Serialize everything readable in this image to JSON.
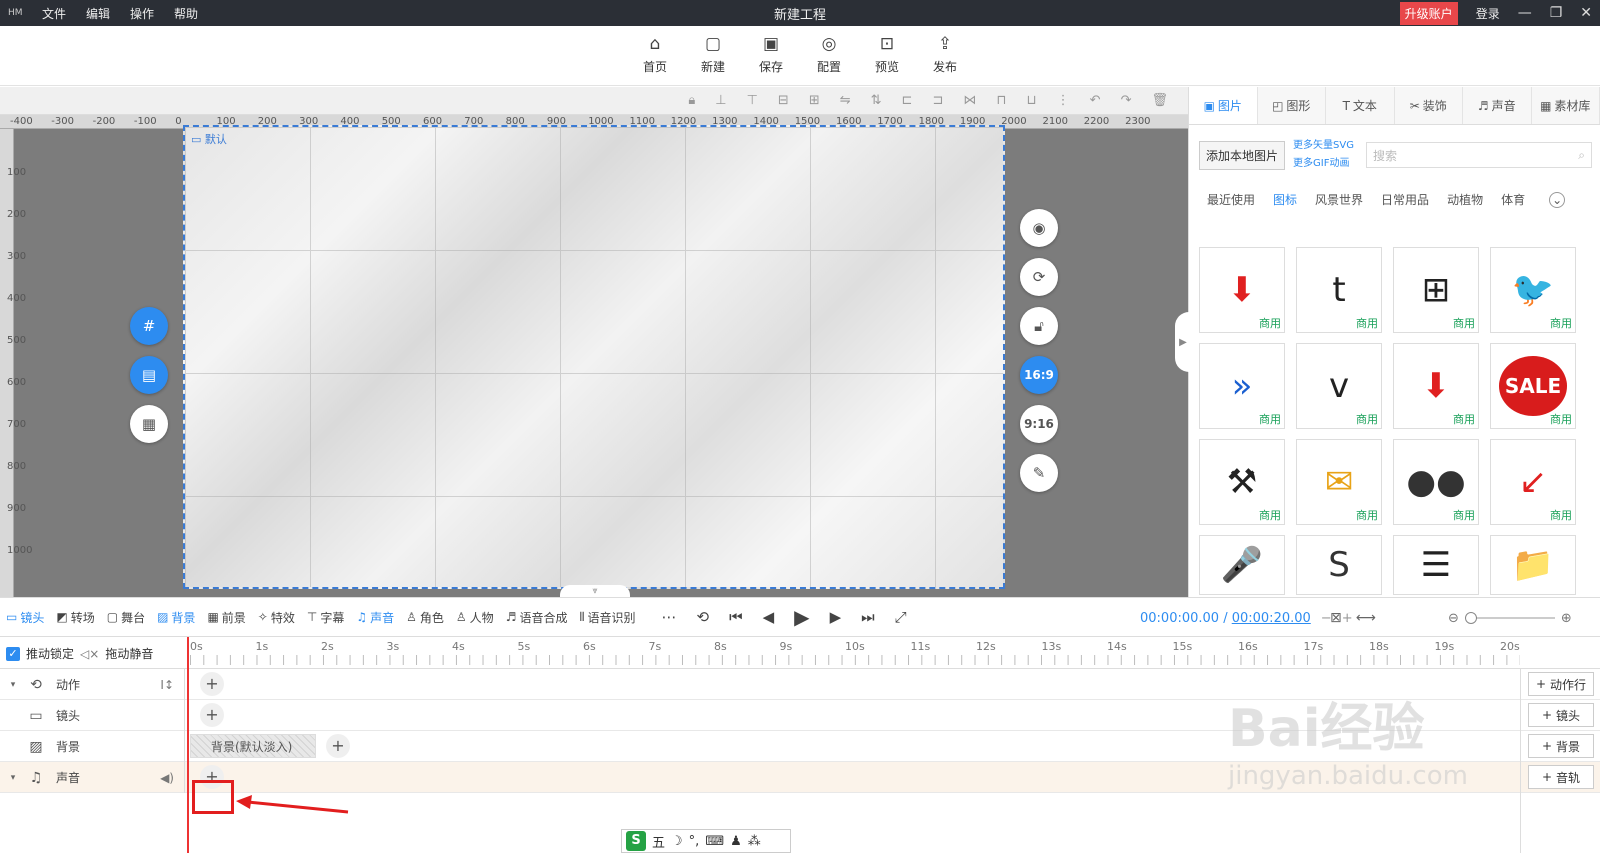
{
  "titlebar": {
    "logo": "HM",
    "menu": [
      "文件",
      "编辑",
      "操作",
      "帮助"
    ],
    "title": "新建工程",
    "upgrade": "升级账户",
    "login": "登录"
  },
  "toolbar": [
    {
      "label": "首页",
      "icon": "home-icon",
      "glyph": "⌂"
    },
    {
      "label": "新建",
      "icon": "new-file-icon",
      "glyph": "▢"
    },
    {
      "label": "保存",
      "icon": "save-icon",
      "glyph": "▣"
    },
    {
      "label": "配置",
      "icon": "settings-icon",
      "glyph": "◎"
    },
    {
      "label": "预览",
      "icon": "preview-icon",
      "glyph": "⊡"
    },
    {
      "label": "发布",
      "icon": "publish-icon",
      "glyph": "⇪"
    }
  ],
  "ruler_top": [
    "-400",
    "-300",
    "-200",
    "-100",
    "0",
    "100",
    "200",
    "300",
    "400",
    "500",
    "600",
    "700",
    "800",
    "900",
    "1000",
    "1100",
    "1200",
    "1300",
    "1400",
    "1500",
    "1600",
    "1700",
    "1800",
    "1900",
    "2000",
    "2100",
    "2200",
    "2300"
  ],
  "ruler_left": [
    "100",
    "200",
    "300",
    "400",
    "500",
    "600",
    "700",
    "800",
    "900",
    "1000"
  ],
  "canvas": {
    "scene_label": "默认",
    "ratio_169": "16:9",
    "ratio_916": "9:16"
  },
  "right_panel": {
    "tabs": [
      "图片",
      "图形",
      "文本",
      "装饰",
      "声音",
      "素材库"
    ],
    "add_local": "添加本地图片",
    "more_svg": "更多矢量SVG",
    "more_gif": "更多GIF动画",
    "search_placeholder": "搜索",
    "categories": [
      "最近使用",
      "图标",
      "风景世界",
      "日常用品",
      "动植物",
      "体育"
    ],
    "tiles": [
      {
        "icon": "download-arrow-icon",
        "glyph": "⬇",
        "color": "#e02020",
        "tag": "商用"
      },
      {
        "icon": "tumblr-icon",
        "glyph": "t",
        "color": "#222",
        "tag": "商用"
      },
      {
        "icon": "windows-icon",
        "glyph": "⊞",
        "color": "#222",
        "tag": "商用"
      },
      {
        "icon": "twitter-icon",
        "glyph": "🐦",
        "color": "#222",
        "tag": "商用"
      },
      {
        "icon": "fast-forward-icon",
        "glyph": "»",
        "color": "#1a5fd0",
        "tag": "商用"
      },
      {
        "icon": "vimeo-icon",
        "glyph": "v",
        "color": "#222",
        "tag": "商用"
      },
      {
        "icon": "location-arrow-icon",
        "glyph": "⬇",
        "color": "#e02020",
        "tag": "商用"
      },
      {
        "icon": "sale-badge-icon",
        "glyph": "SALE",
        "color": "#d81c1c",
        "tag": "商用"
      },
      {
        "icon": "tools-icon",
        "glyph": "⚒",
        "color": "#222",
        "tag": "商用"
      },
      {
        "icon": "mail-icon",
        "glyph": "✉",
        "color": "#e8a317",
        "tag": "商用"
      },
      {
        "icon": "flickr-icon",
        "glyph": "●●",
        "color": "#333",
        "tag": "商用"
      },
      {
        "icon": "sale-arrow-icon",
        "glyph": "↙",
        "color": "#e02020",
        "tag": "商用"
      },
      {
        "icon": "microphone-icon",
        "glyph": "🎤",
        "color": "#e02020",
        "tag": ""
      },
      {
        "icon": "skype-icon",
        "glyph": "S",
        "color": "#333",
        "tag": ""
      },
      {
        "icon": "receipt-icon",
        "glyph": "☰",
        "color": "#222",
        "tag": ""
      },
      {
        "icon": "folder-icon",
        "glyph": "📁",
        "color": "#1a7fd0",
        "tag": ""
      }
    ]
  },
  "timeline_bar": {
    "items": [
      {
        "label": "镜头",
        "glyph": "▭",
        "active": true
      },
      {
        "label": "转场",
        "glyph": "◩",
        "active": false
      },
      {
        "label": "舞台",
        "glyph": "▢",
        "active": false
      },
      {
        "label": "背景",
        "glyph": "▨",
        "active": true
      },
      {
        "label": "前景",
        "glyph": "▦",
        "active": false
      },
      {
        "label": "特效",
        "glyph": "✧",
        "active": false
      },
      {
        "label": "字幕",
        "glyph": "⊤",
        "active": false
      },
      {
        "label": "声音",
        "glyph": "♫",
        "active": true
      },
      {
        "label": "角色",
        "glyph": "♙",
        "active": false
      },
      {
        "label": "人物",
        "glyph": "♙",
        "active": false
      },
      {
        "label": "语音合成",
        "glyph": "♬",
        "active": false
      },
      {
        "label": "语音识别",
        "glyph": "⫴",
        "active": false
      }
    ],
    "time_current": "00:00:00.00",
    "time_sep": " / ",
    "time_total": "00:00:20.00"
  },
  "timeline": {
    "lock_label": "推动锁定",
    "mute_label": "拖动静音",
    "ticks": [
      "0s",
      "1s",
      "2s",
      "3s",
      "4s",
      "5s",
      "6s",
      "7s",
      "8s",
      "9s",
      "10s",
      "11s",
      "12s",
      "13s",
      "14s",
      "15s",
      "16s",
      "17s",
      "18s",
      "19s",
      "20s"
    ],
    "rows": [
      {
        "label": "动作",
        "icon": "action-icon",
        "glyph": "⟲",
        "expand": "▾",
        "extra": "I↕",
        "right": "动作行"
      },
      {
        "label": "镜头",
        "icon": "camera-icon",
        "glyph": "▭",
        "expand": "",
        "extra": "",
        "right": "镜头"
      },
      {
        "label": "背景",
        "icon": "background-icon",
        "glyph": "▨",
        "expand": "",
        "extra": "",
        "right": "背景"
      },
      {
        "label": "声音",
        "icon": "music-icon",
        "glyph": "♫",
        "expand": "▾",
        "extra": "◀)",
        "right": "音轨"
      }
    ],
    "bg_clip": "背景(默认淡入)"
  },
  "watermark": {
    "big": "Bai经验",
    "small": "jingyan.baidu.com"
  },
  "ime": {
    "s": "S",
    "items": [
      "五",
      "☽",
      "°,",
      "⌨",
      "♟",
      "⁂"
    ]
  }
}
